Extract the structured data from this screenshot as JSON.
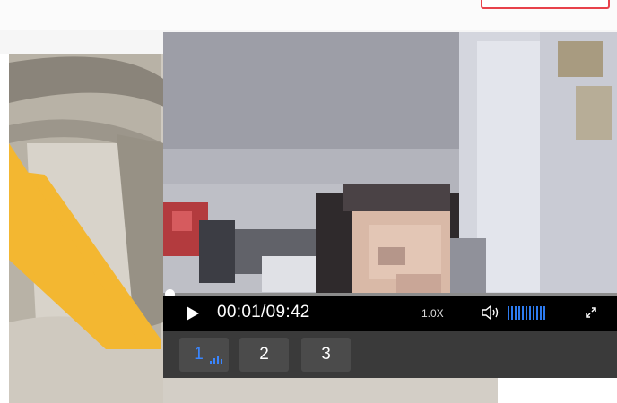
{
  "player": {
    "time_display": "00:01/09:42",
    "speed": "1.0X",
    "volume_level": 1.0,
    "progress": 0.002
  },
  "channels": [
    {
      "label": "1",
      "active": true
    },
    {
      "label": "2",
      "active": false
    },
    {
      "label": "3",
      "active": false
    }
  ],
  "colors": {
    "accent": "#3a86ff",
    "volume_fill": "#2d7bf0",
    "top_button_border": "#e8424b",
    "decor_yellow": "#f3b731"
  },
  "icons": [
    "play-icon",
    "volume-icon",
    "fullscreen-icon",
    "signal-bars-icon"
  ]
}
